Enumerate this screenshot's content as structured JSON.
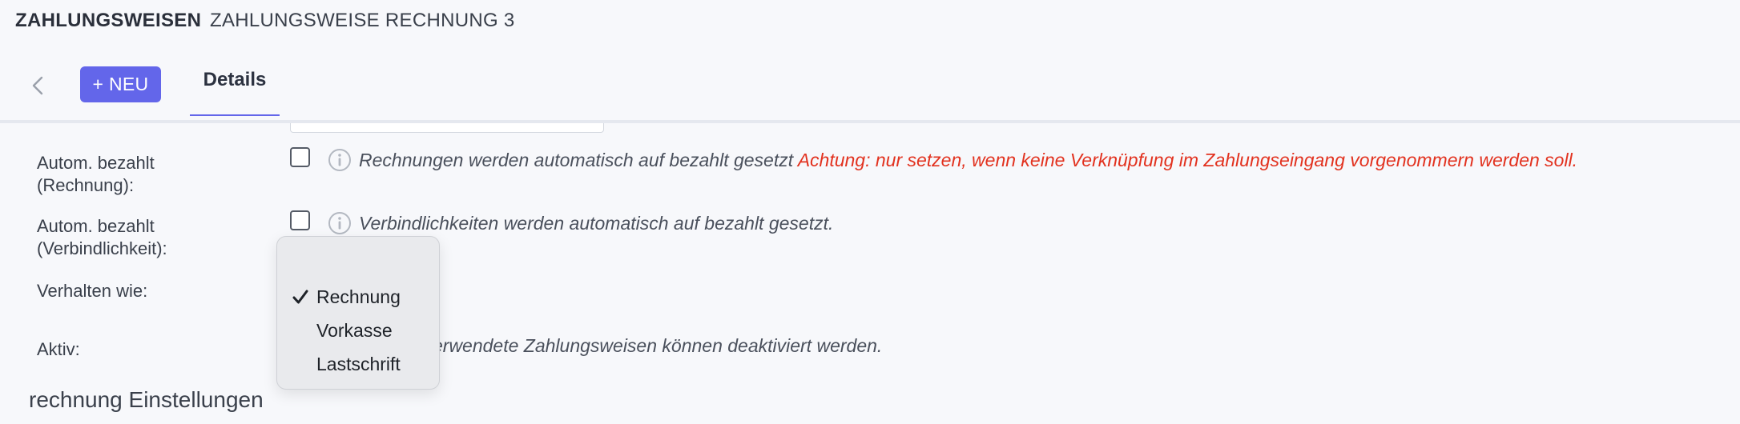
{
  "header": {
    "section": "ZAHLUNGSWEISEN",
    "record": "ZAHLUNGSWEISE RECHNUNG 3"
  },
  "toolbar": {
    "new_label": "+ NEU",
    "tab_details": "Details"
  },
  "form": {
    "auto_paid_invoice": {
      "label_line1": "Autom. bezahlt",
      "label_line2": "(Rechnung):",
      "checked": false,
      "hint": "Rechnungen werden automatisch auf bezahlt gesetzt",
      "warning": "Achtung: nur setzen, wenn keine Verknüpfung im Zahlungseingang vorgenommern werden soll."
    },
    "auto_paid_liability": {
      "label_line1": "Autom. bezahlt",
      "label_line2": "(Verbindlichkeit):",
      "checked": false,
      "hint": "Verbindlichkeiten werden automatisch auf bezahlt gesetzt."
    },
    "behave_like": {
      "label": "Verhalten wie:",
      "options": [
        "Rechnung",
        "Vorkasse",
        "Lastschrift"
      ],
      "selected": "Rechnung"
    },
    "active": {
      "label": "Aktiv:",
      "hint_visible": "erwendete Zahlungsweisen können deaktiviert werden."
    }
  },
  "section_title": "rechnung Einstellungen",
  "icons": {
    "back": "chevron-left-icon",
    "info": "info-icon",
    "check": "checkmark-icon"
  },
  "colors": {
    "accent": "#6366ea",
    "warning": "#e2321f",
    "background": "#f7f8fb"
  }
}
